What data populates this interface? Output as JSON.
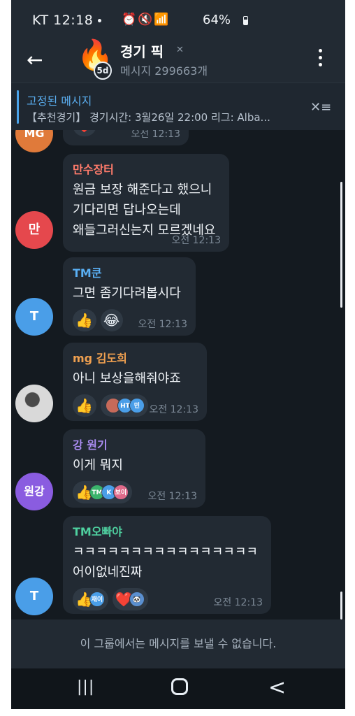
{
  "status_bar": {
    "carrier_time": "KT 12:18",
    "icons": "⏰🔇📶",
    "battery": "64%"
  },
  "header": {
    "back_icon": "←",
    "avatar_emoji": "🔥",
    "days_badge": "5d",
    "title": "경기 픽",
    "mute_icon": "🔇",
    "subtitle": "메시지 299663개"
  },
  "pinned": {
    "title": "고정된 메시지",
    "text": "【추천경기】 경기시간: 3월26일 22:00 리그: Alba...",
    "unpin_icon": "✕≡"
  },
  "messages": [
    {
      "avatar_text": "MG",
      "avatar_color": "#e07a3a",
      "sender": "",
      "lines": [],
      "reactions": [
        {
          "emoji": "❤️",
          "avatars": []
        }
      ],
      "time": "오전 12:13"
    },
    {
      "avatar_text": "만",
      "avatar_color": "#e5484d",
      "sender": "만수장터",
      "sender_color": "#ff7b6b",
      "lines": [
        "원금 보장 해준다고 했으니",
        "기다리면 답나오는데",
        "왜들그러신는지 모르겠네요"
      ],
      "reactions": [],
      "time": "오전 12:13"
    },
    {
      "avatar_text": "T",
      "avatar_color": "#4a9ee8",
      "sender": "TM쿤",
      "sender_color": "#5ab0f5",
      "lines": [
        "그면 좀기다려봅시다"
      ],
      "reactions": [
        {
          "emoji": "👍",
          "avatars": []
        },
        {
          "emoji": "😂",
          "avatars": []
        }
      ],
      "time": "오전 12:13"
    },
    {
      "avatar_text": "",
      "avatar_color": "#d9d9d9",
      "sender": "mg 김도희",
      "sender_color": "#f0a050",
      "lines": [
        "아니 보상을해줘야죠"
      ],
      "reactions": [
        {
          "emoji": "👍",
          "avatars": []
        },
        {
          "emoji": "",
          "avatars": [
            {
              "text": "",
              "color": "#c76a5a"
            },
            {
              "text": "HT",
              "color": "#4a9ee8"
            },
            {
              "text": "민",
              "color": "#4a9ee8"
            }
          ]
        }
      ],
      "time": "오전 12:13"
    },
    {
      "avatar_text": "원강",
      "avatar_color": "#8a5ce0",
      "sender": "강 원기",
      "sender_color": "#a98bf0",
      "lines": [
        "이게 뭐지"
      ],
      "reactions": [
        {
          "emoji": "👍",
          "avatars": [
            {
              "text": "TM",
              "color": "#3ab36b"
            },
            {
              "text": "K",
              "color": "#4a9ee8"
            },
            {
              "text": "보이",
              "color": "#e06a8a"
            }
          ]
        }
      ],
      "time": "오전 12:13"
    },
    {
      "avatar_text": "T",
      "avatar_color": "#4a9ee8",
      "sender": "TM오빠야",
      "sender_color": "#4fd1a0",
      "lines": [
        "ㅋㅋㅋㅋㅋㅋㅋㅋㅋㅋㅋㅋㅋㅋㅋㅋ",
        "어이없네진짜"
      ],
      "reactions": [
        {
          "emoji": "👍",
          "avatars": [
            {
              "text": "재이",
              "color": "#4a9ee8"
            }
          ]
        },
        {
          "emoji": "❤️",
          "avatars": [
            {
              "text": "🐼",
              "color": "#5a8fd0"
            }
          ]
        }
      ],
      "time": "오전 12:13"
    }
  ],
  "footer": {
    "notice": "이 그룹에서는 메시지를 보낼 수 없습니다."
  },
  "nav": {
    "recent_icon": "|||",
    "back_icon": "<"
  }
}
